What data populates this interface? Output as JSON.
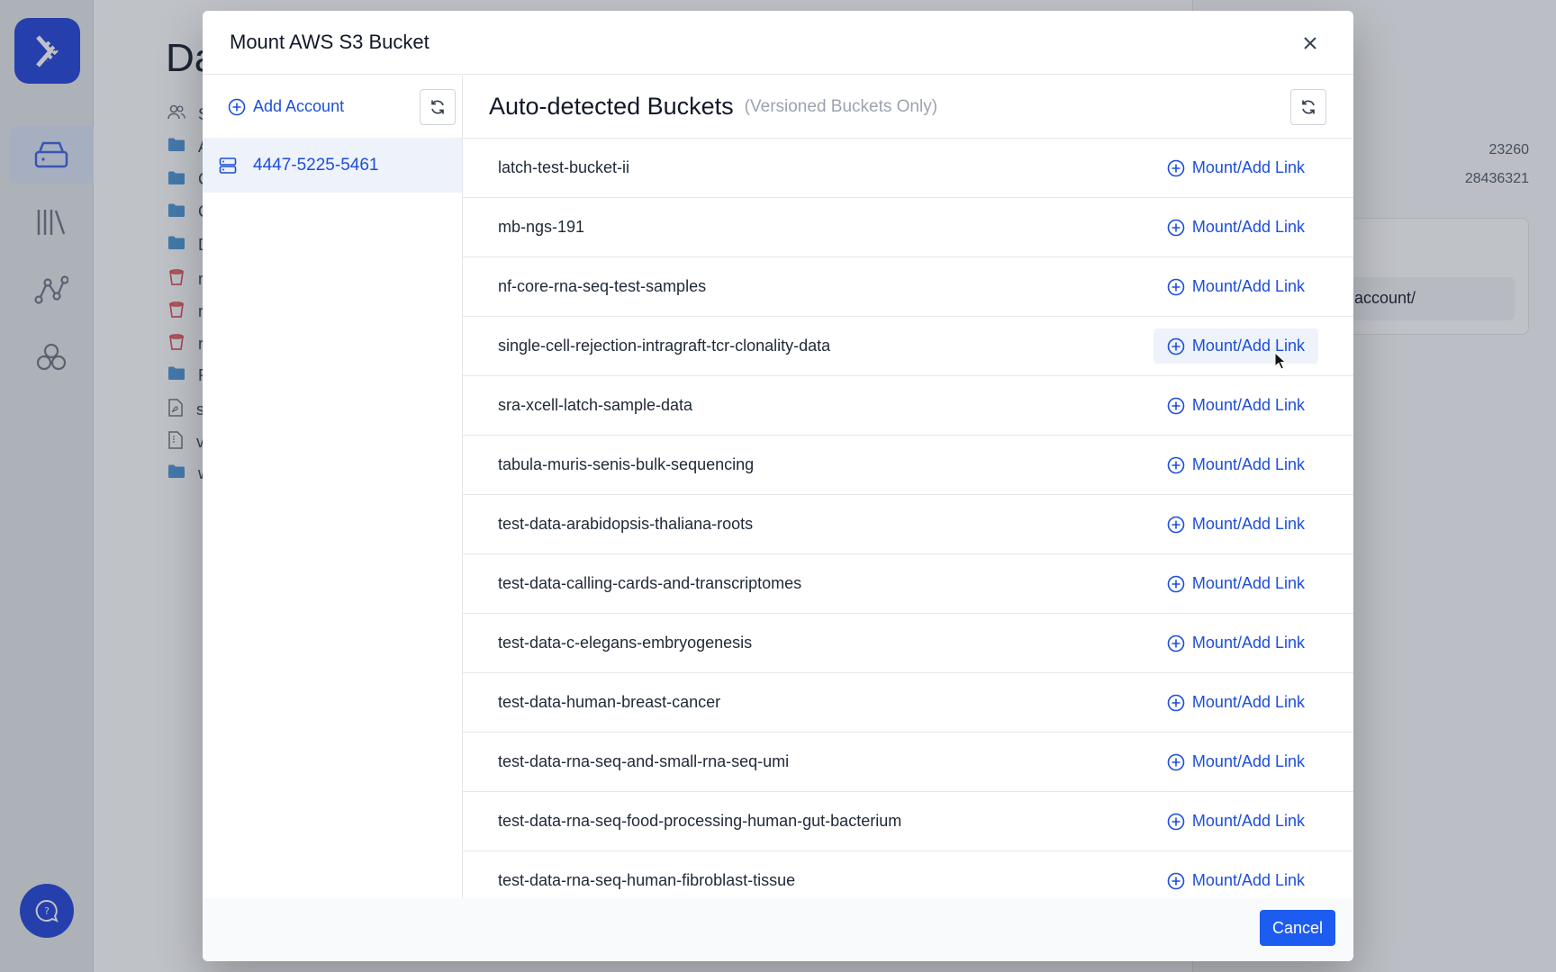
{
  "background": {
    "page_title": "Da",
    "rows": [
      {
        "icon": "users-icon",
        "label": "S"
      },
      {
        "icon": "folder-icon",
        "label": "A"
      },
      {
        "icon": "folder-icon",
        "label": "C"
      },
      {
        "icon": "folder-icon",
        "label": "C"
      },
      {
        "icon": "folder-icon",
        "label": "D"
      },
      {
        "icon": "bucket-icon",
        "label": "r"
      },
      {
        "icon": "bucket-icon",
        "label": "r"
      },
      {
        "icon": "bucket-icon",
        "label": "r"
      },
      {
        "icon": "folder-icon",
        "label": "R"
      },
      {
        "icon": "pdf-file-icon",
        "label": "s"
      },
      {
        "icon": "file-icon",
        "label": "v"
      },
      {
        "icon": "folder-icon",
        "label": "w"
      }
    ],
    "stats": [
      "23260",
      "28436321"
    ],
    "account_path": "account/"
  },
  "modal": {
    "title": "Mount AWS S3 Bucket",
    "add_account_label": "Add Account",
    "accounts": [
      "4447-5225-5461"
    ],
    "heading": "Auto-detected Buckets",
    "subheading": "(Versioned Buckets Only)",
    "mount_label": "Mount/Add Link",
    "buckets": [
      "latch-test-bucket-ii",
      "mb-ngs-191",
      "nf-core-rna-seq-test-samples",
      "single-cell-rejection-intragraft-tcr-clonality-data",
      "sra-xcell-latch-sample-data",
      "tabula-muris-senis-bulk-sequencing",
      "test-data-arabidopsis-thaliana-roots",
      "test-data-calling-cards-and-transcriptomes",
      "test-data-c-elegans-embryogenesis",
      "test-data-human-breast-cancer",
      "test-data-rna-seq-and-small-rna-seq-umi",
      "test-data-rna-seq-food-processing-human-gut-bacterium",
      "test-data-rna-seq-human-fibroblast-tissue"
    ],
    "hovered_bucket": "single-cell-rejection-intragraft-tcr-clonality-data",
    "cancel_label": "Cancel"
  },
  "colors": {
    "accent": "#1d4ed8",
    "brand": "#1d3fd8",
    "primary_button": "#1d5cf0"
  }
}
